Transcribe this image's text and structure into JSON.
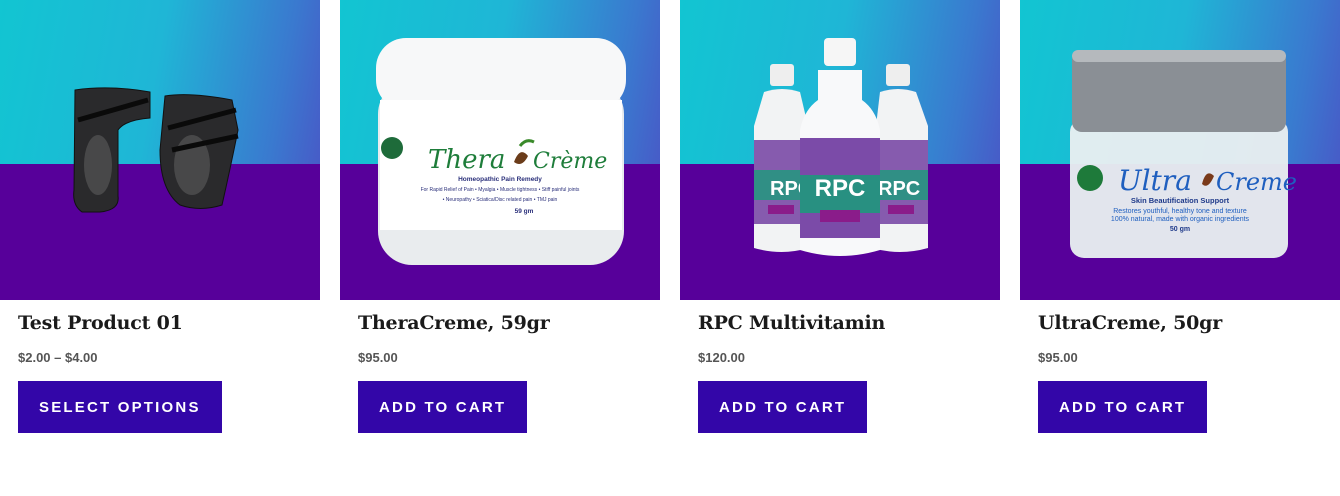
{
  "products": [
    {
      "title": "Test Product 01",
      "price": "$2.00 – $4.00",
      "button": "SELECT OPTIONS",
      "image_icon": "ankle-brace-image"
    },
    {
      "title": "TheraCreme, 59gr",
      "price": "$95.00",
      "button": "ADD TO CART",
      "image_icon": "theracreme-jar-image",
      "label": {
        "brand_left": "Thera",
        "brand_right": "Crème",
        "subtitle": "Homeopathic Pain Remedy",
        "line1": "For Rapid Relief of Pain • Myalgia • Muscle tightness • Stiff painful joints",
        "line2": "• Neuropathy • Sciatica/Disc related pain • TMJ pain",
        "weight": "59 gm"
      }
    },
    {
      "title": "RPC Multivitamin",
      "price": "$120.00",
      "button": "ADD TO CART",
      "image_icon": "rpc-bottles-image",
      "label": {
        "brand": "RPC"
      }
    },
    {
      "title": "UltraCreme, 50gr",
      "price": "$95.00",
      "button": "ADD TO CART",
      "image_icon": "ultracreme-jar-image",
      "label": {
        "brand_left": "Ultra",
        "brand_right": "Creme",
        "subtitle": "Skin Beautification Support",
        "line1": "Restores youthful, healthy tone and texture",
        "line2": "100% natural, made with organic ingredients",
        "weight": "50 gm"
      }
    }
  ],
  "colors": {
    "button_bg": "#3306a8",
    "purple_band": "#57009a",
    "teal": "#12c5d2"
  }
}
